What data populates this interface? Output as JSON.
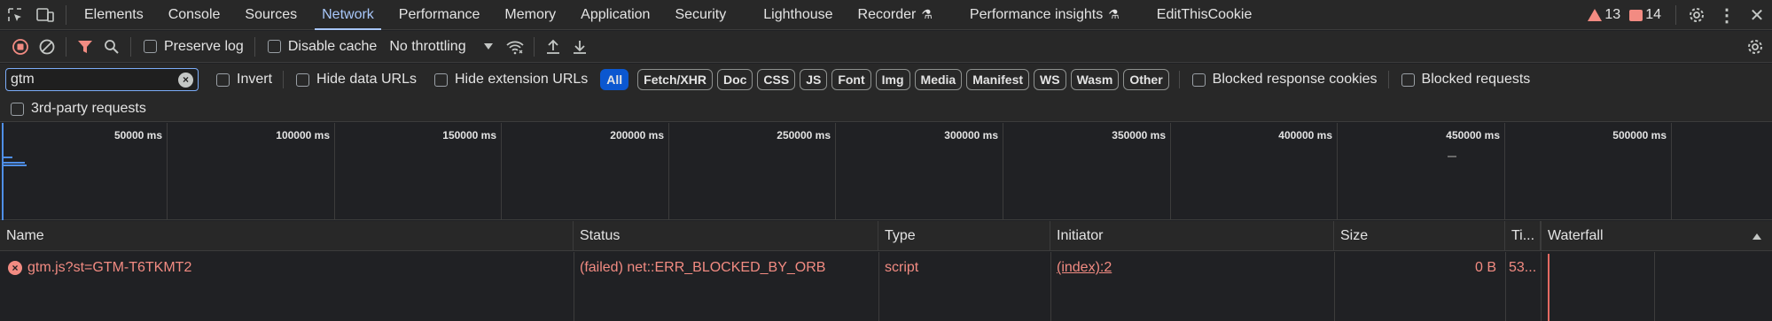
{
  "tabs": [
    {
      "label": "Elements",
      "active": false
    },
    {
      "label": "Console",
      "active": false
    },
    {
      "label": "Sources",
      "active": false
    },
    {
      "label": "Network",
      "active": true
    },
    {
      "label": "Performance",
      "active": false
    },
    {
      "label": "Memory",
      "active": false
    },
    {
      "label": "Application",
      "active": false
    },
    {
      "label": "Security",
      "active": false
    },
    {
      "label": "Lighthouse",
      "active": false
    },
    {
      "label": "Recorder",
      "active": false,
      "flask": true
    },
    {
      "label": "Performance insights",
      "active": false,
      "flask": true
    },
    {
      "label": "EditThisCookie",
      "active": false
    }
  ],
  "issues": {
    "warnings": "13",
    "errors": "14"
  },
  "toolbar": {
    "preserve_log": "Preserve log",
    "disable_cache": "Disable cache",
    "throttling": "No throttling"
  },
  "filter": {
    "value": "gtm",
    "invert": "Invert",
    "hide_data_urls": "Hide data URLs",
    "hide_extension_urls": "Hide extension URLs",
    "types": [
      "All",
      "Fetch/XHR",
      "Doc",
      "CSS",
      "JS",
      "Font",
      "Img",
      "Media",
      "Manifest",
      "WS",
      "Wasm",
      "Other"
    ],
    "active_type": "All",
    "blocked_response_cookies": "Blocked response cookies",
    "blocked_requests": "Blocked requests",
    "third_party": "3rd-party requests"
  },
  "overview": {
    "ticks": [
      "50000 ms",
      "100000 ms",
      "150000 ms",
      "200000 ms",
      "250000 ms",
      "300000 ms",
      "350000 ms",
      "400000 ms",
      "450000 ms",
      "500000 ms"
    ]
  },
  "table": {
    "headers": {
      "name": "Name",
      "status": "Status",
      "type": "Type",
      "initiator": "Initiator",
      "size": "Size",
      "time": "Ti...",
      "waterfall": "Waterfall"
    },
    "rows": [
      {
        "name": "gtm.js?st=GTM-T6TKMT2",
        "status": "(failed) net::ERR_BLOCKED_BY_ORB",
        "type": "script",
        "initiator": "(index):2",
        "size": "0 B",
        "time": "53..."
      }
    ]
  },
  "colors": {
    "accent": "#a8c7fa",
    "error": "#f28b82",
    "background": "#202124"
  }
}
